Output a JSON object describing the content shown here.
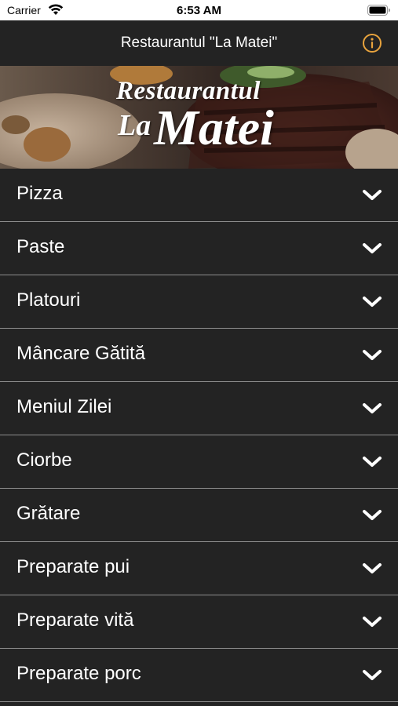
{
  "status_bar": {
    "carrier": "Carrier",
    "time": "6:53 AM"
  },
  "nav_bar": {
    "title": "Restaurantul \"La Matei\"",
    "info_icon": "info-circle-icon",
    "accent_color": "#e8a33d"
  },
  "banner": {
    "logo_line1": "Restaurantul",
    "logo_line2_prefix": "La",
    "logo_line2_main": "Matei"
  },
  "menu": {
    "chevron_icon": "chevron-down-icon",
    "items": [
      {
        "label": "Pizza"
      },
      {
        "label": "Paste"
      },
      {
        "label": "Platouri"
      },
      {
        "label": "Mâncare Gătită"
      },
      {
        "label": "Meniul Zilei"
      },
      {
        "label": "Ciorbe"
      },
      {
        "label": "Grătare"
      },
      {
        "label": "Preparate pui"
      },
      {
        "label": "Preparate vită"
      },
      {
        "label": "Preparate porc"
      }
    ]
  },
  "colors": {
    "background": "#232323",
    "divider": "#8e8e8e",
    "text": "#ffffff"
  }
}
